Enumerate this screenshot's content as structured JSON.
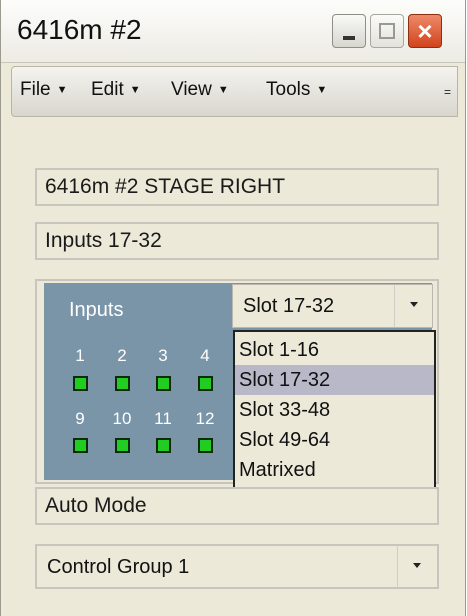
{
  "window": {
    "title": "6416m #2"
  },
  "menubar": {
    "items": [
      {
        "label": "File"
      },
      {
        "label": "Edit"
      },
      {
        "label": "View"
      },
      {
        "label": "Tools"
      }
    ],
    "overflow_glyph": "="
  },
  "device_name": "6416m #2 STAGE RIGHT",
  "inputs_range_label": "Inputs 17-32",
  "inputs_panel": {
    "label": "Inputs",
    "channels_row1": [
      "1",
      "2",
      "3",
      "4"
    ],
    "channels_row2": [
      "9",
      "10",
      "11",
      "12"
    ],
    "led_color": "#22cc22"
  },
  "slot_select": {
    "value": "Slot 17-32",
    "options": [
      "Slot 1-16",
      "Slot 17-32",
      "Slot 33-48",
      "Slot 49-64",
      "Matrixed"
    ],
    "selected_index": 1
  },
  "mode_label": "Auto Mode",
  "control_group": {
    "value": "Control Group 1"
  },
  "colors": {
    "panel": "#7a94a8",
    "close_button": "#d1431c",
    "selection": "#b9b8c8"
  }
}
